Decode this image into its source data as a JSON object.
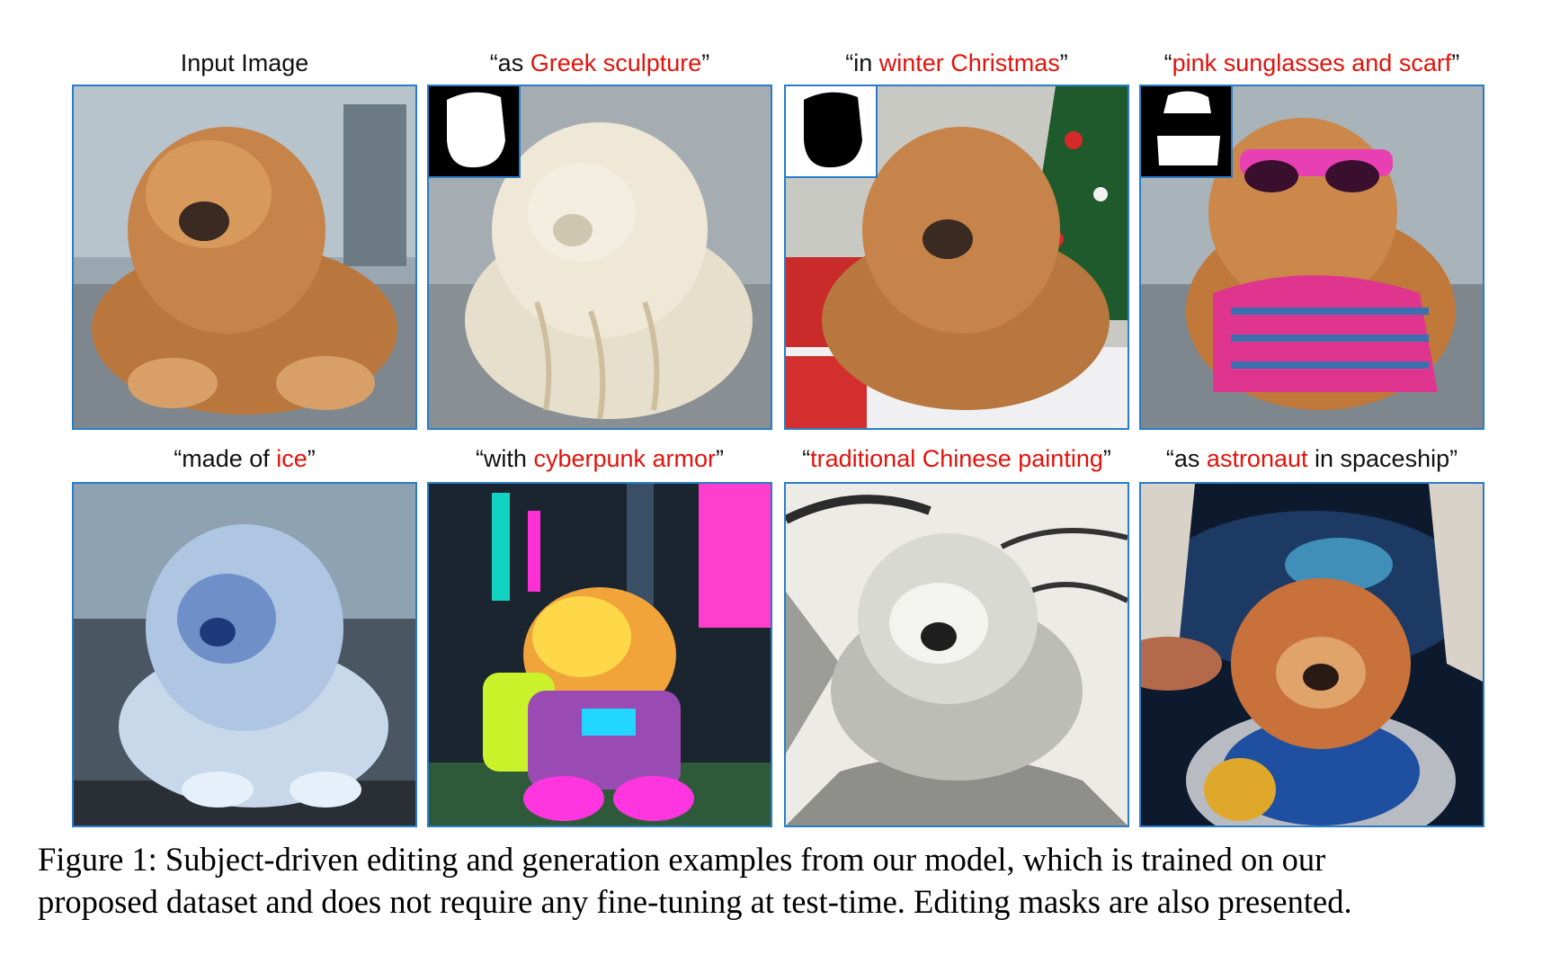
{
  "panels": [
    {
      "pre": "Input Image",
      "hl": "",
      "post": ""
    },
    {
      "pre": "“as ",
      "hl": "Greek sculpture",
      "post": "”"
    },
    {
      "pre": "“in ",
      "hl": "winter Christmas",
      "post": "”"
    },
    {
      "pre": "“",
      "hl": "pink sunglasses and scarf",
      "post": "”"
    },
    {
      "pre": "“made of ",
      "hl": "ice",
      "post": "”"
    },
    {
      "pre": "“with ",
      "hl": "cyberpunk armor",
      "post": "”"
    },
    {
      "pre": "“",
      "hl": "traditional Chinese painting",
      "post": "”"
    },
    {
      "pre": "“as ",
      "hl": "astronaut",
      "post": " in spaceship”"
    }
  ],
  "caption": {
    "line1": "Figure 1: Subject-driven editing and generation examples from our model, which is trained on our",
    "line2": "proposed dataset and does not require any fine-tuning at test-time. Editing masks are also presented."
  },
  "colors": {
    "highlight": "#e3120b",
    "frame": "#2a7cc7"
  }
}
